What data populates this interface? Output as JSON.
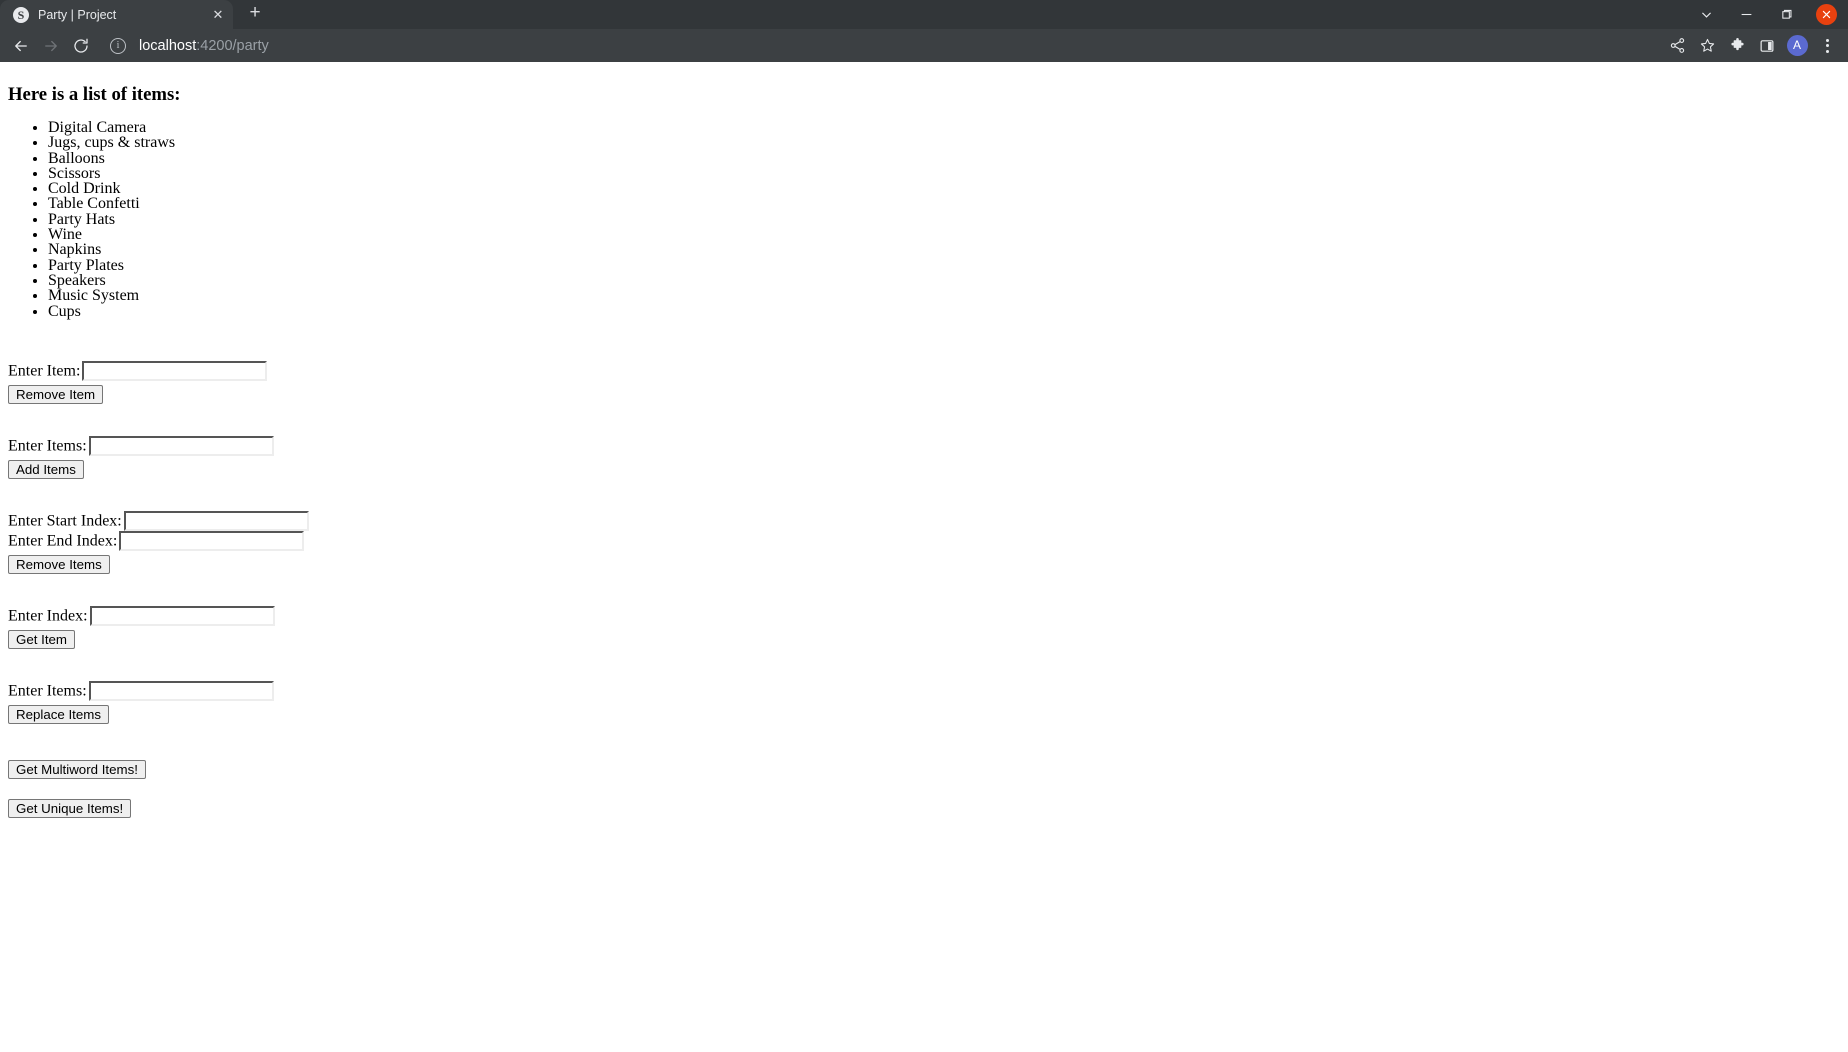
{
  "window": {
    "controls": {
      "tab_search_label": "chevron-down",
      "minimize_label": "minimize",
      "maximize_label": "maximize",
      "close_label": "close"
    }
  },
  "tabstrip": {
    "tabs": [
      {
        "title": "Party | Project",
        "favicon": "S",
        "close_label": "✕"
      }
    ],
    "new_tab_label": "+"
  },
  "toolbar": {
    "back_label": "back-arrow",
    "forward_label": "forward-arrow",
    "reload_label": "reload",
    "site_info_label": "i",
    "url_host": "localhost",
    "url_rest": ":4200/party",
    "url_full": "localhost:4200/party",
    "share_label": "share",
    "bookmark_label": "bookmark-star",
    "extensions_label": "extensions-puzzle",
    "sidepanel_label": "side-panel",
    "profile_initial": "A",
    "menu_label": "three-dot-menu"
  },
  "page": {
    "heading": "Here is a list of items:",
    "items": [
      "Digital Camera",
      "Jugs, cups & straws",
      "Balloons",
      "Scissors",
      "Cold Drink",
      "Table Confetti",
      "Party Hats",
      "Wine",
      "Napkins",
      "Party Plates",
      "Speakers",
      "Music System",
      "Cups"
    ],
    "sections": {
      "remove_item": {
        "label": "Enter Item:",
        "input_value": "",
        "input_placeholder": "",
        "button": "Remove Item"
      },
      "add_items": {
        "label": "Enter Items:",
        "input_value": "",
        "input_placeholder": "",
        "button": "Add Items"
      },
      "remove_items": {
        "start_label": "Enter Start Index:",
        "start_value": "",
        "end_label": "Enter End Index:",
        "end_value": "",
        "button": "Remove Items"
      },
      "get_item": {
        "label": "Enter Index:",
        "input_value": "",
        "input_placeholder": "",
        "button": "Get Item"
      },
      "replace_items": {
        "label": "Enter Items:",
        "input_value": "",
        "input_placeholder": "",
        "button": "Replace Items"
      },
      "multiword": {
        "button": "Get Multiword Items!"
      },
      "unique": {
        "button": "Get Unique Items!"
      }
    }
  }
}
